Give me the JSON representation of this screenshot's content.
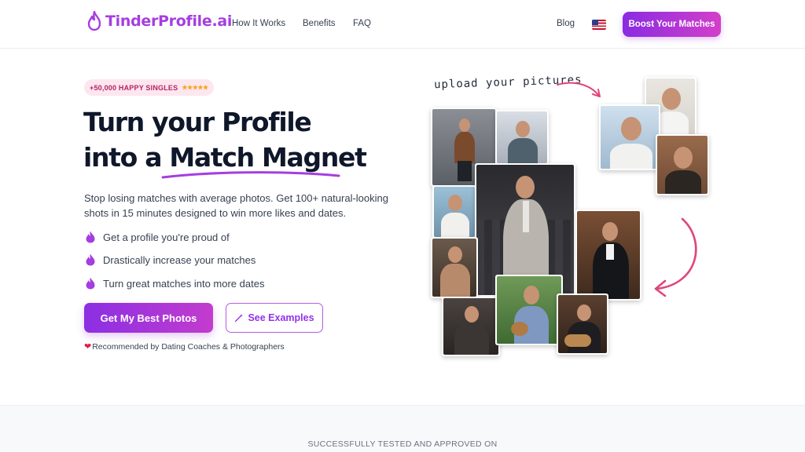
{
  "nav": {
    "logo_text": "TinderProfile.ai",
    "links": [
      "How It Works",
      "Benefits",
      "FAQ"
    ],
    "blog": "Blog",
    "flag": "us-flag-icon",
    "cta": "Boost Your Matches"
  },
  "hero": {
    "badge_text": "+50,000 HAPPY SINGLES",
    "badge_stars": "★★★★★",
    "title_line1": "Turn your Profile",
    "title_line2": "into a Match Magnet",
    "subtitle": "Stop losing matches with average photos. Get 100+ natural-looking shots in 15 minutes designed to win more likes and dates.",
    "features": [
      "Get a profile you're proud of",
      "Drastically increase your matches",
      "Turn great matches into more dates"
    ],
    "primary_cta": "Get My Best Photos",
    "secondary_cta": "See Examples",
    "recommended": "Recommended by Dating Coaches & Photographers",
    "upload_label": "upload your pictures"
  },
  "footer_band": {
    "tested_text": "SUCCESSFULLY TESTED AND APPROVED ON"
  },
  "colors": {
    "brand_purple": "#a53ee0",
    "gradient_start": "#8a2be2",
    "gradient_end": "#d33fc9",
    "arrow_pink": "#e0457b"
  }
}
